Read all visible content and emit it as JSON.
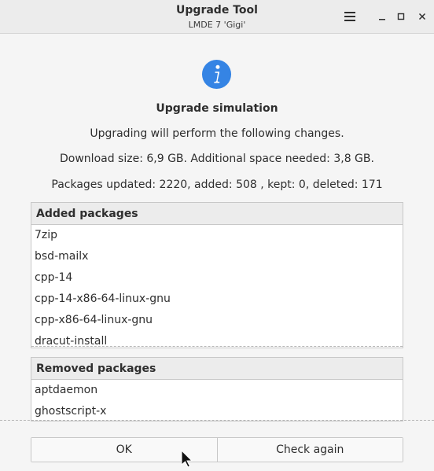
{
  "window": {
    "title": "Upgrade Tool",
    "subtitle": "LMDE 7 'Gigi'"
  },
  "dialog": {
    "heading": "Upgrade simulation",
    "line1": "Upgrading will perform the following changes.",
    "line2": "Download size: 6,9 GB. Additional space needed: 3,8 GB.",
    "line3": "Packages updated: 2220, added: 508 , kept: 0, deleted: 171"
  },
  "added": {
    "header": "Added packages",
    "items": [
      "7zip",
      "bsd-mailx",
      "cpp-14",
      "cpp-14-x86-64-linux-gnu",
      "cpp-x86-64-linux-gnu",
      "dracut-install"
    ]
  },
  "removed": {
    "header": "Removed packages",
    "items": [
      "aptdaemon",
      "ghostscript-x"
    ]
  },
  "buttons": {
    "ok": "OK",
    "check_again": "Check again"
  },
  "icons": {
    "menu": "hamburger-menu-icon",
    "minimize": "minimize-icon",
    "maximize": "maximize-icon",
    "close": "close-icon",
    "info": "info-icon",
    "cursor": "mouse-pointer-icon"
  },
  "colors": {
    "accent": "#3584e4",
    "background": "#f5f5f5",
    "titlebar": "#ececec"
  }
}
